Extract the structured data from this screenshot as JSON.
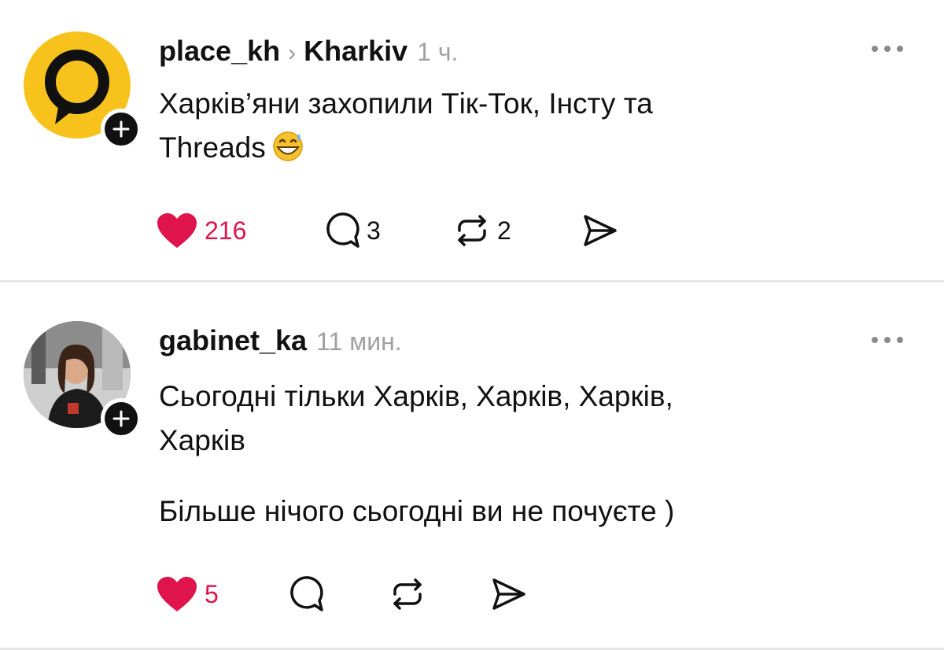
{
  "posts": [
    {
      "username": "place_kh",
      "breadcrumb_separator": "›",
      "community": "Kharkiv",
      "time": "1 ч.",
      "text_lines": [
        "Харків’яни захопили Тік-Ток, Інсту та",
        "Threads"
      ],
      "text_emoji": "grinning-face-with-sweat-icon",
      "avatar": "location-pin-logo",
      "likes": "216",
      "replies": "3",
      "reposts": "2",
      "liked": true
    },
    {
      "username": "gabinet_ka",
      "time": "11 мин.",
      "text_lines": [
        "Сьогодні тільки Харків, Харків, Харків,",
        "Харків",
        "",
        "Більше нічого сьогодні ви не почуєте )"
      ],
      "avatar": "user-photo",
      "likes": "5",
      "replies": "",
      "reposts": "",
      "liked": true
    }
  ],
  "colors": {
    "like": "#e0144c",
    "avatar_yellow": "#f7c21b",
    "time_gray": "#a0a0a0"
  }
}
